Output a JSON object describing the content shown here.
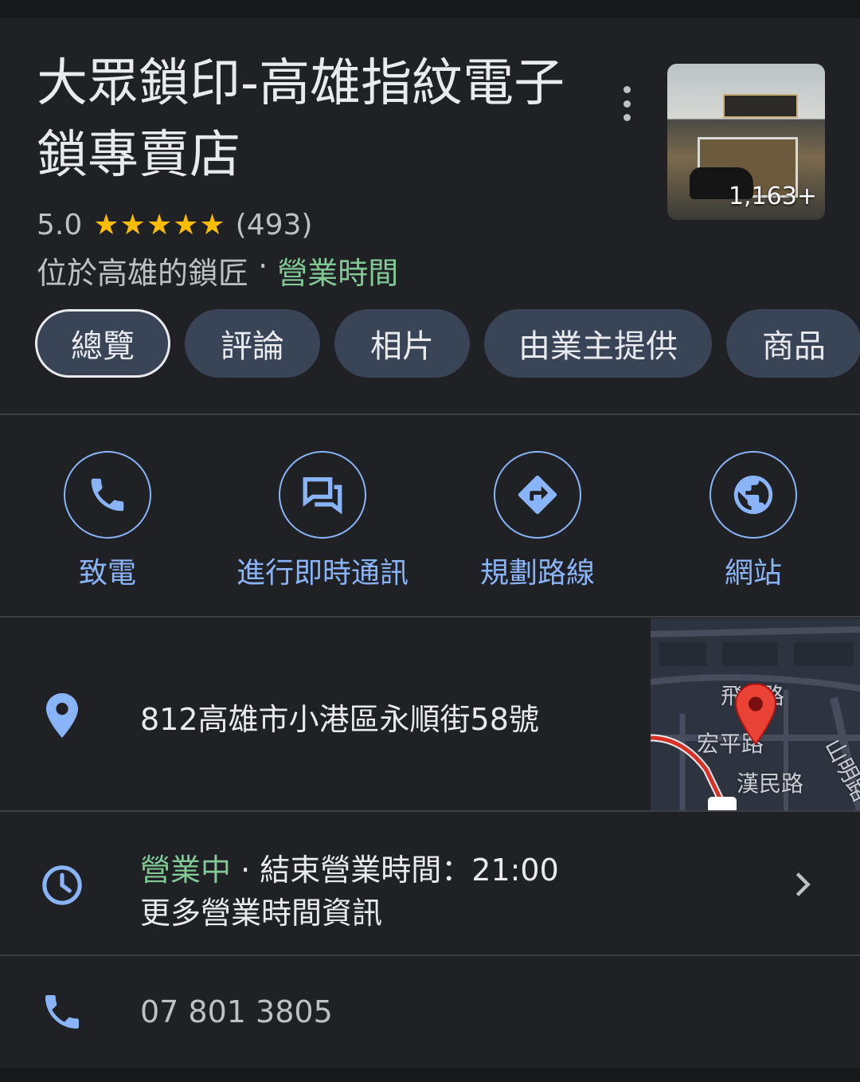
{
  "place": {
    "title": "大眾鎖印-高雄指紋電子鎖專賣店",
    "photo_count": "1,163+",
    "rating": "5.0",
    "stars": 5,
    "review_count": "(493)",
    "category": "位於高雄的鎖匠",
    "separator": " · ",
    "hours_link": "營業時間"
  },
  "tabs": [
    {
      "label": "總覽",
      "active": true
    },
    {
      "label": "評論"
    },
    {
      "label": "相片"
    },
    {
      "label": "由業主提供"
    },
    {
      "label": "商品"
    }
  ],
  "actions": [
    {
      "label": "致電",
      "icon": "phone-icon"
    },
    {
      "label": "進行即時通訊",
      "icon": "chat-icon"
    },
    {
      "label": "規劃路線",
      "icon": "directions-icon"
    },
    {
      "label": "網站",
      "icon": "globe-icon"
    }
  ],
  "address": {
    "text": "812高雄市小港區永順街58號",
    "icon": "location-pin-icon"
  },
  "map": {
    "labels": [
      "飛",
      "路",
      "宏平路",
      "漢民路",
      "山明路"
    ]
  },
  "hours": {
    "status": "營業中",
    "separator": " · ",
    "closing": "結束營業時間：21:00",
    "more": "更多營業時間資訊",
    "icon": "clock-icon"
  },
  "phone": {
    "number": "07 801 3805",
    "icon": "phone-icon"
  },
  "colors": {
    "background": "#202124",
    "accent": "#8ab4f8",
    "open_green": "#81c995",
    "star": "#fbbc04",
    "chip": "#394457"
  }
}
